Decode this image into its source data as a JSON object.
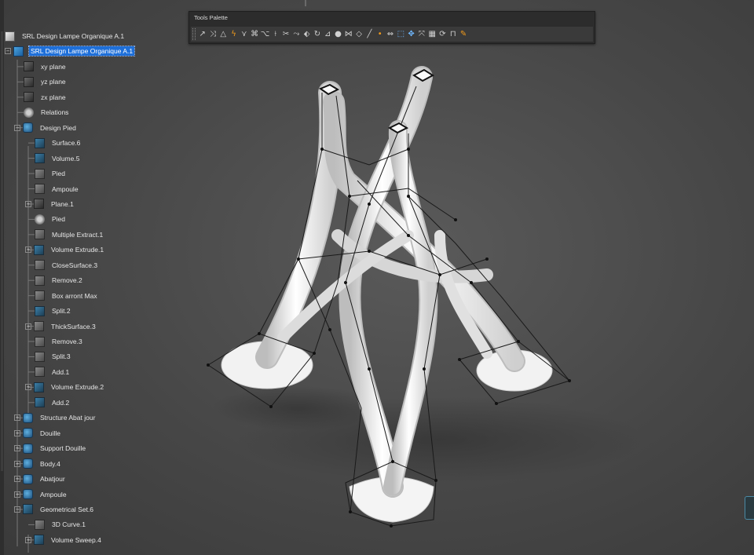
{
  "toolbar": {
    "title": "Tools Palette",
    "tools": [
      {
        "icon": "vertex-arrow-icon",
        "glyph": "↗",
        "color": "#d0d0d0"
      },
      {
        "icon": "multi-vertex-icon",
        "glyph": "⤨",
        "color": "#d0d0d0"
      },
      {
        "icon": "triangle-mesh-icon",
        "glyph": "△",
        "color": "#d0d0d0"
      },
      {
        "icon": "orange-curve-icon",
        "glyph": "ϟ",
        "color": "#f29b1b"
      },
      {
        "icon": "bridge-icon",
        "glyph": "⋎",
        "color": "#d0d0d0"
      },
      {
        "icon": "extrude-icon",
        "glyph": "⌘",
        "color": "#d0d0d0"
      },
      {
        "icon": "split-icon",
        "glyph": "⌥",
        "color": "#d0d0d0"
      },
      {
        "icon": "weld-icon",
        "glyph": "⟊",
        "color": "#d0d0d0"
      },
      {
        "icon": "cut-icon",
        "glyph": "✂",
        "color": "#d0d0d0"
      },
      {
        "icon": "stretch-icon",
        "glyph": "⤳",
        "color": "#d0d0d0"
      },
      {
        "icon": "bevel-icon",
        "glyph": "⬖",
        "color": "#d0d0d0"
      },
      {
        "icon": "rotate-icon",
        "glyph": "↻",
        "color": "#d0d0d0"
      },
      {
        "icon": "symmetry-icon",
        "glyph": "⊿",
        "color": "#d0d0d0"
      },
      {
        "icon": "sphere-icon",
        "glyph": "●",
        "color": "#d0d0d0"
      },
      {
        "icon": "subdivide-icon",
        "glyph": "⋈",
        "color": "#d0d0d0"
      },
      {
        "icon": "diamond-icon",
        "glyph": "◇",
        "color": "#d0d0d0"
      },
      {
        "icon": "line-icon",
        "glyph": "╱",
        "color": "#d0d0d0"
      },
      {
        "icon": "dot-icon",
        "glyph": "•",
        "color": "#f29b1b"
      },
      {
        "icon": "link-icon",
        "glyph": "⇔",
        "color": "#d0d0d0"
      },
      {
        "icon": "box-select-icon",
        "glyph": "⬚",
        "color": "#6fb8ff"
      },
      {
        "icon": "move-icon",
        "glyph": "✥",
        "color": "#6fb8ff"
      },
      {
        "icon": "scale-icon",
        "glyph": "⤧",
        "color": "#d0d0d0"
      },
      {
        "icon": "grid-icon",
        "glyph": "▦",
        "color": "#d0d0d0"
      },
      {
        "icon": "sync-icon",
        "glyph": "⟳",
        "color": "#d0d0d0"
      },
      {
        "icon": "lock-icon",
        "glyph": "⊓",
        "color": "#d0d0d0"
      },
      {
        "icon": "orange-edit-icon",
        "glyph": "✎",
        "color": "#f29b1b"
      }
    ]
  },
  "tree": {
    "items": [
      {
        "label": "SRL Design Lampe Organique A.1",
        "icon": "root-icon",
        "level": 0,
        "expander": "",
        "selected": false
      },
      {
        "label": "SRL Design Lampe Organique A.1",
        "icon": "product-icon",
        "level": 1,
        "expander": "−",
        "selected": true
      },
      {
        "label": "xy plane",
        "icon": "plane-icon",
        "level": 2,
        "expander": "",
        "selected": false
      },
      {
        "label": "yz plane",
        "icon": "plane-icon",
        "level": 2,
        "expander": "",
        "selected": false
      },
      {
        "label": "zx plane",
        "icon": "plane-icon",
        "level": 2,
        "expander": "",
        "selected": false
      },
      {
        "label": "Relations",
        "icon": "relations-icon",
        "level": 2,
        "expander": "",
        "selected": false
      },
      {
        "label": "Design Pied",
        "icon": "body-icon",
        "level": 2,
        "expander": "−",
        "selected": false
      },
      {
        "label": "Surface.6",
        "icon": "surface-icon",
        "level": 3,
        "expander": "",
        "selected": false
      },
      {
        "label": "Volume.5",
        "icon": "volume-icon",
        "level": 3,
        "expander": "",
        "selected": false
      },
      {
        "label": "Pied",
        "icon": "feature-icon",
        "level": 3,
        "expander": "",
        "selected": false
      },
      {
        "label": "Ampoule",
        "icon": "feature-icon",
        "level": 3,
        "expander": "",
        "selected": false
      },
      {
        "label": "Plane.1",
        "icon": "plane-icon",
        "level": 3,
        "expander": "+",
        "selected": false
      },
      {
        "label": "Pied",
        "icon": "relations-icon",
        "level": 3,
        "expander": "",
        "selected": false
      },
      {
        "label": "Multiple Extract.1",
        "icon": "feature-icon",
        "level": 3,
        "expander": "",
        "selected": false
      },
      {
        "label": "Volume Extrude.1",
        "icon": "volume-icon",
        "level": 3,
        "expander": "+",
        "selected": false
      },
      {
        "label": "CloseSurface.3",
        "icon": "feature-icon",
        "level": 3,
        "expander": "",
        "selected": false
      },
      {
        "label": "Remove.2",
        "icon": "feature-icon",
        "level": 3,
        "expander": "",
        "selected": false
      },
      {
        "label": "Box arront Max",
        "icon": "feature-icon",
        "level": 3,
        "expander": "",
        "selected": false
      },
      {
        "label": "Split.2",
        "icon": "surface-icon",
        "level": 3,
        "expander": "",
        "selected": false
      },
      {
        "label": "ThickSurface.3",
        "icon": "feature-icon",
        "level": 3,
        "expander": "+",
        "selected": false
      },
      {
        "label": "Remove.3",
        "icon": "feature-icon",
        "level": 3,
        "expander": "",
        "selected": false
      },
      {
        "label": "Split.3",
        "icon": "feature-icon",
        "level": 3,
        "expander": "",
        "selected": false
      },
      {
        "label": "Add.1",
        "icon": "feature-icon",
        "level": 3,
        "expander": "",
        "selected": false
      },
      {
        "label": "Volume Extrude.2",
        "icon": "volume-icon",
        "level": 3,
        "expander": "+",
        "selected": false
      },
      {
        "label": "Add.2",
        "icon": "geom-icon",
        "level": 3,
        "expander": "",
        "selected": false
      },
      {
        "label": "Structure Abat jour",
        "icon": "body-icon",
        "level": 2,
        "expander": "+",
        "selected": false
      },
      {
        "label": "Douille",
        "icon": "body-icon",
        "level": 2,
        "expander": "+",
        "selected": false
      },
      {
        "label": "Support Douille",
        "icon": "body-icon",
        "level": 2,
        "expander": "+",
        "selected": false
      },
      {
        "label": "Body.4",
        "icon": "body-icon",
        "level": 2,
        "expander": "+",
        "selected": false
      },
      {
        "label": "Abatjour",
        "icon": "body-icon",
        "level": 2,
        "expander": "+",
        "selected": false
      },
      {
        "label": "Ampoule",
        "icon": "body-icon",
        "level": 2,
        "expander": "+",
        "selected": false
      },
      {
        "label": "Geometrical Set.6",
        "icon": "geom-icon",
        "level": 2,
        "expander": "−",
        "selected": false
      },
      {
        "label": "3D Curve.1",
        "icon": "feature-icon",
        "level": 3,
        "expander": "",
        "selected": false
      },
      {
        "label": "Volume Sweep.4",
        "icon": "geom-icon",
        "level": 3,
        "expander": "+",
        "selected": false
      }
    ]
  }
}
